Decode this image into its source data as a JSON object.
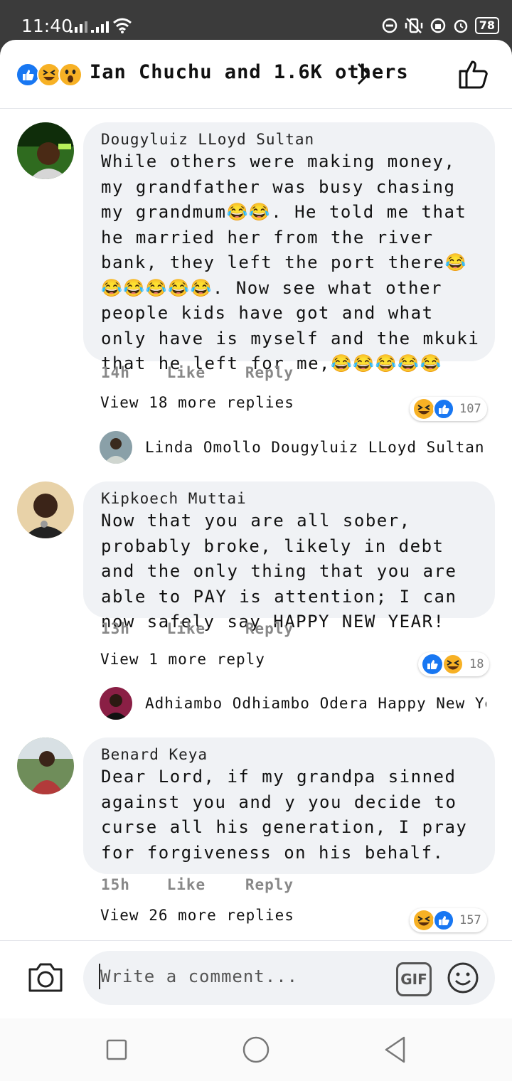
{
  "status": {
    "time": "11:40",
    "battery": "78"
  },
  "header": {
    "reaction_summary": "Ian Chuchu and 1.6K others"
  },
  "comments": [
    {
      "author": "Dougyluiz LLoyd Sultan",
      "text": "While others were making money, my grandfather was busy chasing my grandmum😂😂. He told me that he married her from the river bank, they left the port there😂😂😂😂😂😂. Now see what other people kids have got and what only have is myself and the mkuki that he left for me,😂😂😂😂😂",
      "time": "14h",
      "like": "Like",
      "reply": "Reply",
      "reaction_count": "107",
      "view_more": "View 18 more replies",
      "reply_preview": "Linda Omollo Dougyluiz LLoyd Sultan 😂😂..."
    },
    {
      "author": "Kipkoech Muttai",
      "text": "Now that you are all sober, probably broke, likely in debt and the only thing that you are able to PAY is attention; I can now safely say HAPPY NEW YEAR!",
      "time": "13h",
      "like": "Like",
      "reply": "Reply",
      "reaction_count": "18",
      "view_more": "View 1 more reply",
      "reply_preview": "Adhiambo Odhiambo Odera Happy New Ye..."
    },
    {
      "author": "Benard Keya",
      "text": "Dear Lord, if my grandpa sinned against you and y you decide to curse all his generation, I pray for forgiveness on his behalf.",
      "time": "15h",
      "like": "Like",
      "reply": "Reply",
      "reaction_count": "157",
      "view_more": "View 26 more replies"
    }
  ],
  "composer": {
    "placeholder": "Write a comment...",
    "gif_label": "GIF"
  },
  "colors": {
    "like_blue": "#1877f2",
    "haha_yellow": "#f7b125",
    "bubble_bg": "#f0f2f5"
  }
}
